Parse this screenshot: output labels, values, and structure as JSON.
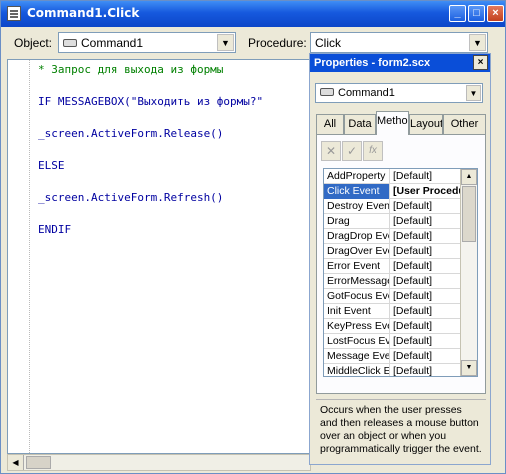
{
  "window": {
    "title": "Command1.Click"
  },
  "toolbar": {
    "object_label": "Object:",
    "object_value": "Command1",
    "procedure_label": "Procedure:",
    "procedure_value": "Click"
  },
  "code_lines": [
    {
      "text": "* Запрос для выхода из формы",
      "kind": "comment"
    },
    {
      "text": "",
      "kind": "blank"
    },
    {
      "text": "IF MESSAGEBOX(\"Выходить из формы?\"",
      "kind": "keyword"
    },
    {
      "text": "",
      "kind": "blank"
    },
    {
      "text": "_screen.ActiveForm.Release()",
      "kind": "keyword"
    },
    {
      "text": "",
      "kind": "blank"
    },
    {
      "text": "ELSE",
      "kind": "keyword"
    },
    {
      "text": "",
      "kind": "blank"
    },
    {
      "text": "_screen.ActiveForm.Refresh()",
      "kind": "keyword"
    },
    {
      "text": "",
      "kind": "blank"
    },
    {
      "text": "ENDIF",
      "kind": "keyword"
    }
  ],
  "properties": {
    "title": "Properties - form2.scx",
    "close_glyph": "×",
    "object": "Command1",
    "tabs": [
      "All",
      "Data",
      "Methods",
      "Layout",
      "Other"
    ],
    "active_tab": 2,
    "tool_glyphs": [
      "✕",
      "✓",
      "fx"
    ],
    "rows": [
      {
        "name": "AddProperty",
        "value": "[Default]"
      },
      {
        "name": "Click Event",
        "value": "[User Procedure]",
        "selected": true
      },
      {
        "name": "Destroy Event",
        "value": "[Default]"
      },
      {
        "name": "Drag",
        "value": "[Default]"
      },
      {
        "name": "DragDrop Event",
        "value": "[Default]"
      },
      {
        "name": "DragOver Event",
        "value": "[Default]"
      },
      {
        "name": "Error Event",
        "value": "[Default]"
      },
      {
        "name": "ErrorMessage",
        "value": "[Default]"
      },
      {
        "name": "GotFocus Event",
        "value": "[Default]"
      },
      {
        "name": "Init Event",
        "value": "[Default]"
      },
      {
        "name": "KeyPress Event",
        "value": "[Default]"
      },
      {
        "name": "LostFocus Event",
        "value": "[Default]"
      },
      {
        "name": "Message Event",
        "value": "[Default]"
      },
      {
        "name": "MiddleClick Event",
        "value": "[Default]"
      }
    ],
    "description": "Occurs when the user presses and then releases a mouse button over an object or when you programmatically trigger the event."
  },
  "colors": {
    "titlebar": "#0a4ed8",
    "selection": "#316ac5",
    "comment": "#008000",
    "keyword": "#0000a0"
  }
}
